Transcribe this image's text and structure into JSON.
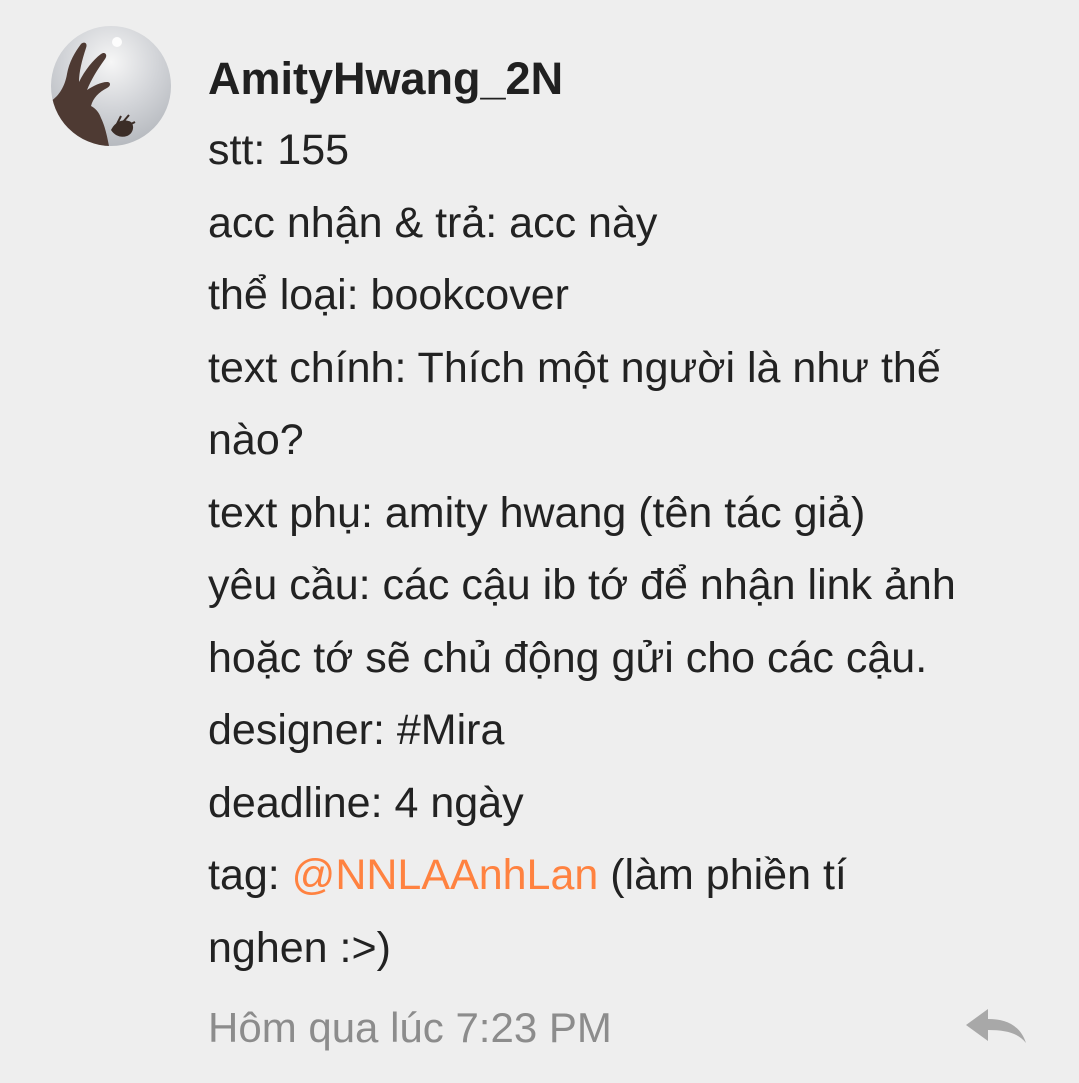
{
  "comment": {
    "username": "AmityHwang_2N",
    "lines": [
      "stt: 155",
      "acc nhận & trả: acc này",
      "thể loại: bookcover",
      "text chính: Thích một người là như thế",
      "nào?",
      "text phụ: amity hwang (tên tác giả)",
      "yêu cầu: các cậu ib tớ để nhận link ảnh",
      "hoặc tớ sẽ chủ động gửi cho các cậu.",
      "designer: #Mira",
      "deadline: 4 ngày"
    ],
    "tag_label": "tag: ",
    "tag_mention": "@NNLAAnhLan",
    "tag_rest": " (làm phiền tí",
    "last_line": "nghen :>)",
    "timestamp": "Hôm qua lúc 7:23 PM",
    "reply_icon": "reply-arrow-icon",
    "colors": {
      "background": "#eeeeee",
      "mention": "#ff8240",
      "timestamp": "#8c8c8c",
      "reply_icon": "#a8a8a8"
    }
  }
}
